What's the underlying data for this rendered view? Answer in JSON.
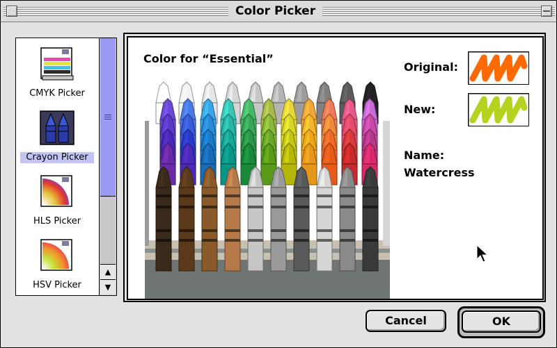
{
  "window": {
    "title": "Color Picker"
  },
  "pickers": [
    {
      "label": "CMYK Picker",
      "icon": "cmyk-picker-icon",
      "selected": false
    },
    {
      "label": "Crayon Picker",
      "icon": "crayon-picker-icon",
      "selected": true
    },
    {
      "label": "HLS Picker",
      "icon": "hls-picker-icon",
      "selected": false
    },
    {
      "label": "HSV Picker",
      "icon": "hsv-picker-icon",
      "selected": false
    }
  ],
  "main": {
    "color_for": "Color for “Essential”",
    "original_label": "Original:",
    "new_label": "New:",
    "name_label": "Name:",
    "name_value": "Watercress"
  },
  "colors": {
    "original": "#ff6a00",
    "new": "#b4d21e",
    "selection_highlight": "#c4c4f4",
    "scroll_thumb": "#9a9af2"
  },
  "buttons": {
    "cancel": "Cancel",
    "ok": "OK"
  },
  "crayon_rows": [
    [
      "#ffffff",
      "#f2f2f2",
      "#e6e6e6",
      "#d6d6d6",
      "#c6c6c6",
      "#b4b4b4",
      "#9c9c9c",
      "#808080",
      "#5a5a5a",
      "#222222"
    ],
    [
      "#6a4ad4",
      "#4a7ae8",
      "#3aa6e8",
      "#3ac6b4",
      "#4ab86a",
      "#a8b84a",
      "#e6d63a",
      "#f2a638",
      "#ee7a5a",
      "#e65a8a",
      "#c66ad6"
    ],
    [
      "#5a3ac6",
      "#3a5ad6",
      "#2a8ad6",
      "#2ab6a6",
      "#3aa65a",
      "#8ab63a",
      "#d6d62a",
      "#f2b62a",
      "#ee8a3a",
      "#e64a6a",
      "#c64aa6"
    ],
    [
      "#4a2ab6",
      "#2a3ac6",
      "#1a7ac6",
      "#1aa696",
      "#2a964a",
      "#6aa62a",
      "#c6c61a",
      "#eea61a",
      "#ee6a2a",
      "#d63a3a",
      "#b63a8a"
    ],
    [
      "#6a2aa6",
      "#4a2ab6",
      "#1a6ab6",
      "#0a9686",
      "#1a8a3a",
      "#5a9a1a",
      "#b6b60a",
      "#e6961a",
      "#e65a1a",
      "#c62a2a",
      "#d62a6a"
    ],
    [
      "#3a2a1a",
      "#5a3a1a",
      "#8a5a2a",
      "#b67a4a",
      "#c6c6c6",
      "#9a9a9a",
      "#5a5a5a",
      "#d6d6d6",
      "#8a8a8a",
      "#3a3a3a"
    ]
  ]
}
